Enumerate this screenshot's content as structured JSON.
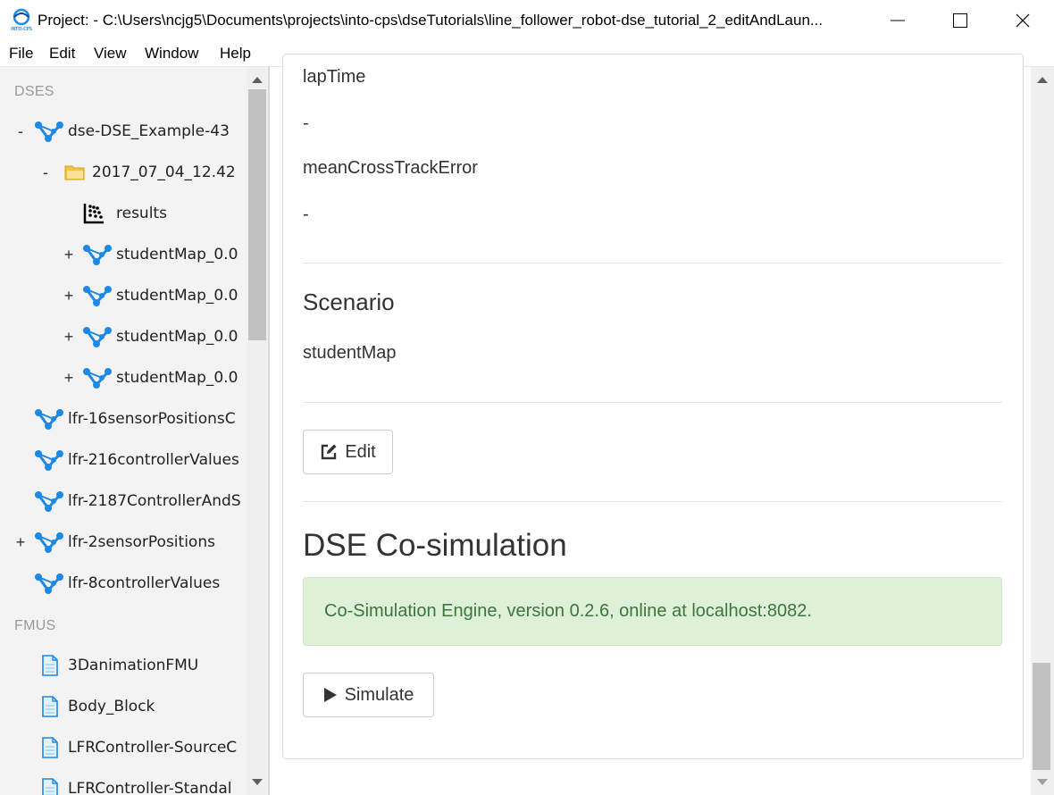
{
  "window": {
    "title": "Project: - C:\\Users\\ncjg5\\Documents\\projects\\into-cps\\dseTutorials\\line_follower_robot-dse_tutorial_2_editAndLaun..."
  },
  "menu": [
    "File",
    "Edit",
    "View",
    "Window",
    "Help"
  ],
  "sidebar": {
    "dses_header": "DSES",
    "dses": [
      {
        "toggle": "-",
        "label": "dse-DSE_Example-43"
      },
      {
        "toggle": "-",
        "label": "2017_07_04_12.42"
      },
      {
        "toggle": "",
        "label": "results"
      },
      {
        "toggle": "+",
        "label": "studentMap_0.0"
      },
      {
        "toggle": "+",
        "label": "studentMap_0.0"
      },
      {
        "toggle": "+",
        "label": "studentMap_0.0"
      },
      {
        "toggle": "+",
        "label": "studentMap_0.0"
      },
      {
        "toggle": "",
        "label": "lfr-16sensorPositionsC"
      },
      {
        "toggle": "",
        "label": "lfr-216controllerValues"
      },
      {
        "toggle": "",
        "label": "lfr-2187ControllerAndS"
      },
      {
        "toggle": "+",
        "label": "lfr-2sensorPositions"
      },
      {
        "toggle": "",
        "label": "lfr-8controllerValues"
      }
    ],
    "fmus_header": "FMUS",
    "fmus": [
      {
        "label": "3DanimationFMU"
      },
      {
        "label": "Body_Block"
      },
      {
        "label": "LFRController-SourceC"
      },
      {
        "label": "LFRController-Standal"
      }
    ]
  },
  "main": {
    "objective1_name": "lapTime",
    "objective1_value": "-",
    "objective2_name": "meanCrossTrackError",
    "objective2_value": "-",
    "scenario_heading": "Scenario",
    "scenario_value": "studentMap",
    "edit_button": "Edit",
    "cosim_heading": "DSE Co-simulation",
    "cosim_status": "Co-Simulation Engine, version 0.2.6, online at localhost:8082.",
    "simulate_button": "Simulate"
  },
  "colors": {
    "dse_icon": "#1e88e5",
    "alert_bg": "#dff0d8",
    "alert_text": "#3c763d"
  }
}
